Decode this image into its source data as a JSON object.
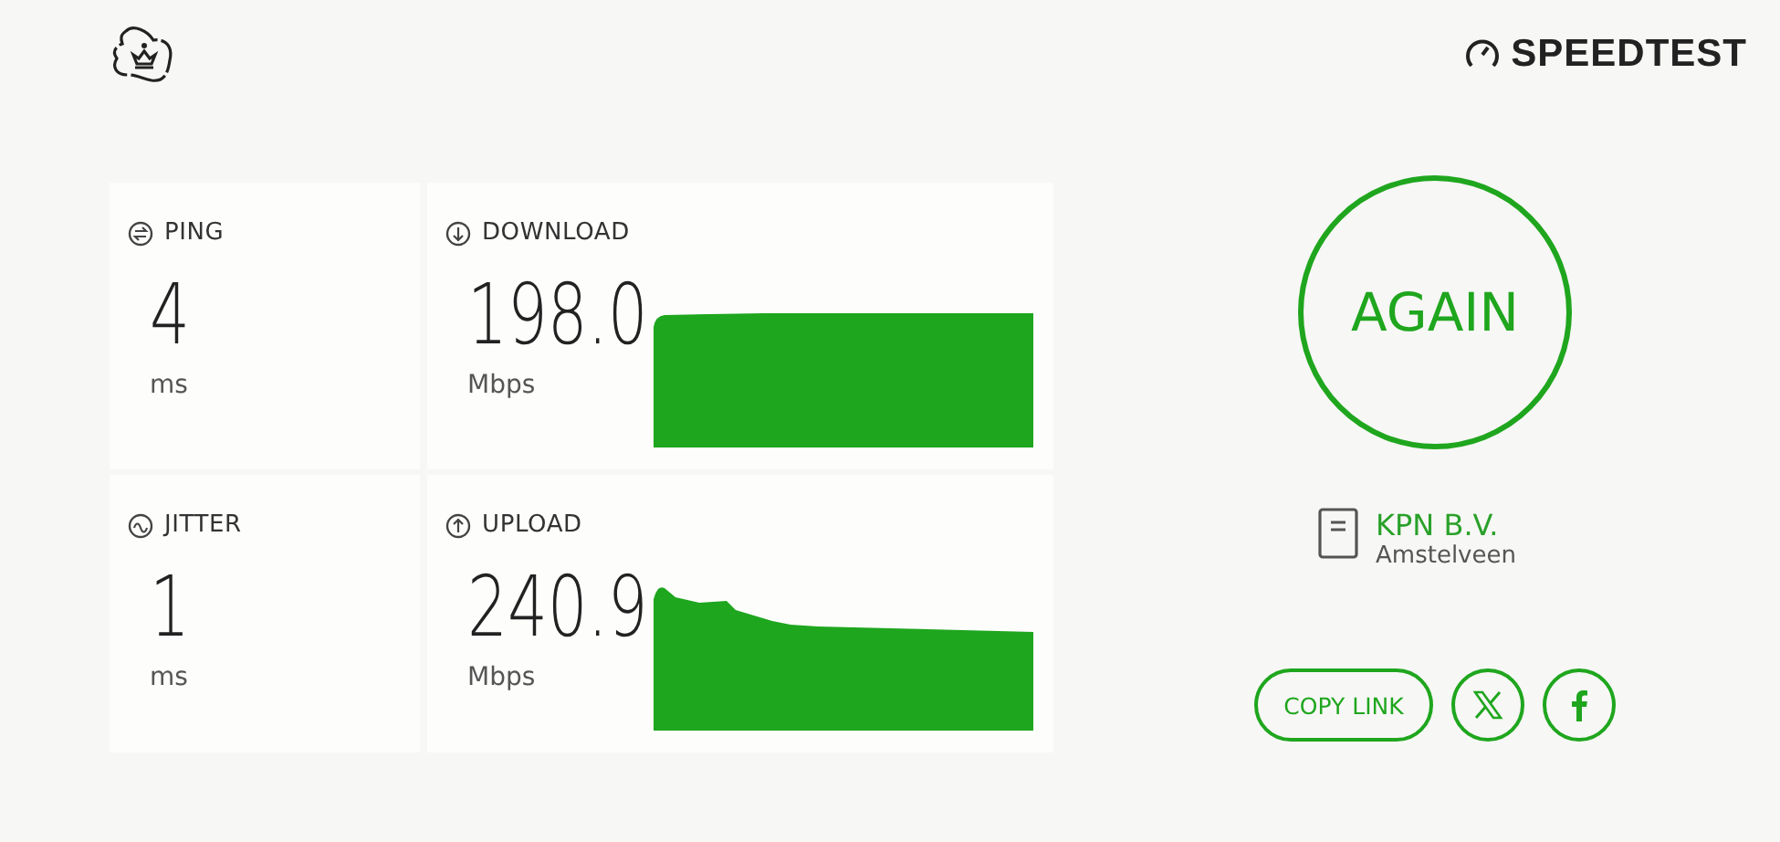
{
  "header": {
    "brand": "SPEEDTEST"
  },
  "metrics": [
    {
      "kind": "ping",
      "label": "PING",
      "value": "4",
      "unit": "ms"
    },
    {
      "kind": "download",
      "label": "DOWNLOAD",
      "value": "198.0",
      "unit": "Mbps"
    },
    {
      "kind": "jitter",
      "label": "JITTER",
      "value": "1",
      "unit": "ms"
    },
    {
      "kind": "upload",
      "label": "UPLOAD",
      "value": "240.9",
      "unit": "Mbps"
    }
  ],
  "again_button": "AGAIN",
  "server": {
    "name": "KPN B.V.",
    "location": "Amstelveen"
  },
  "share": {
    "copy_link": "COPY LINK"
  }
}
